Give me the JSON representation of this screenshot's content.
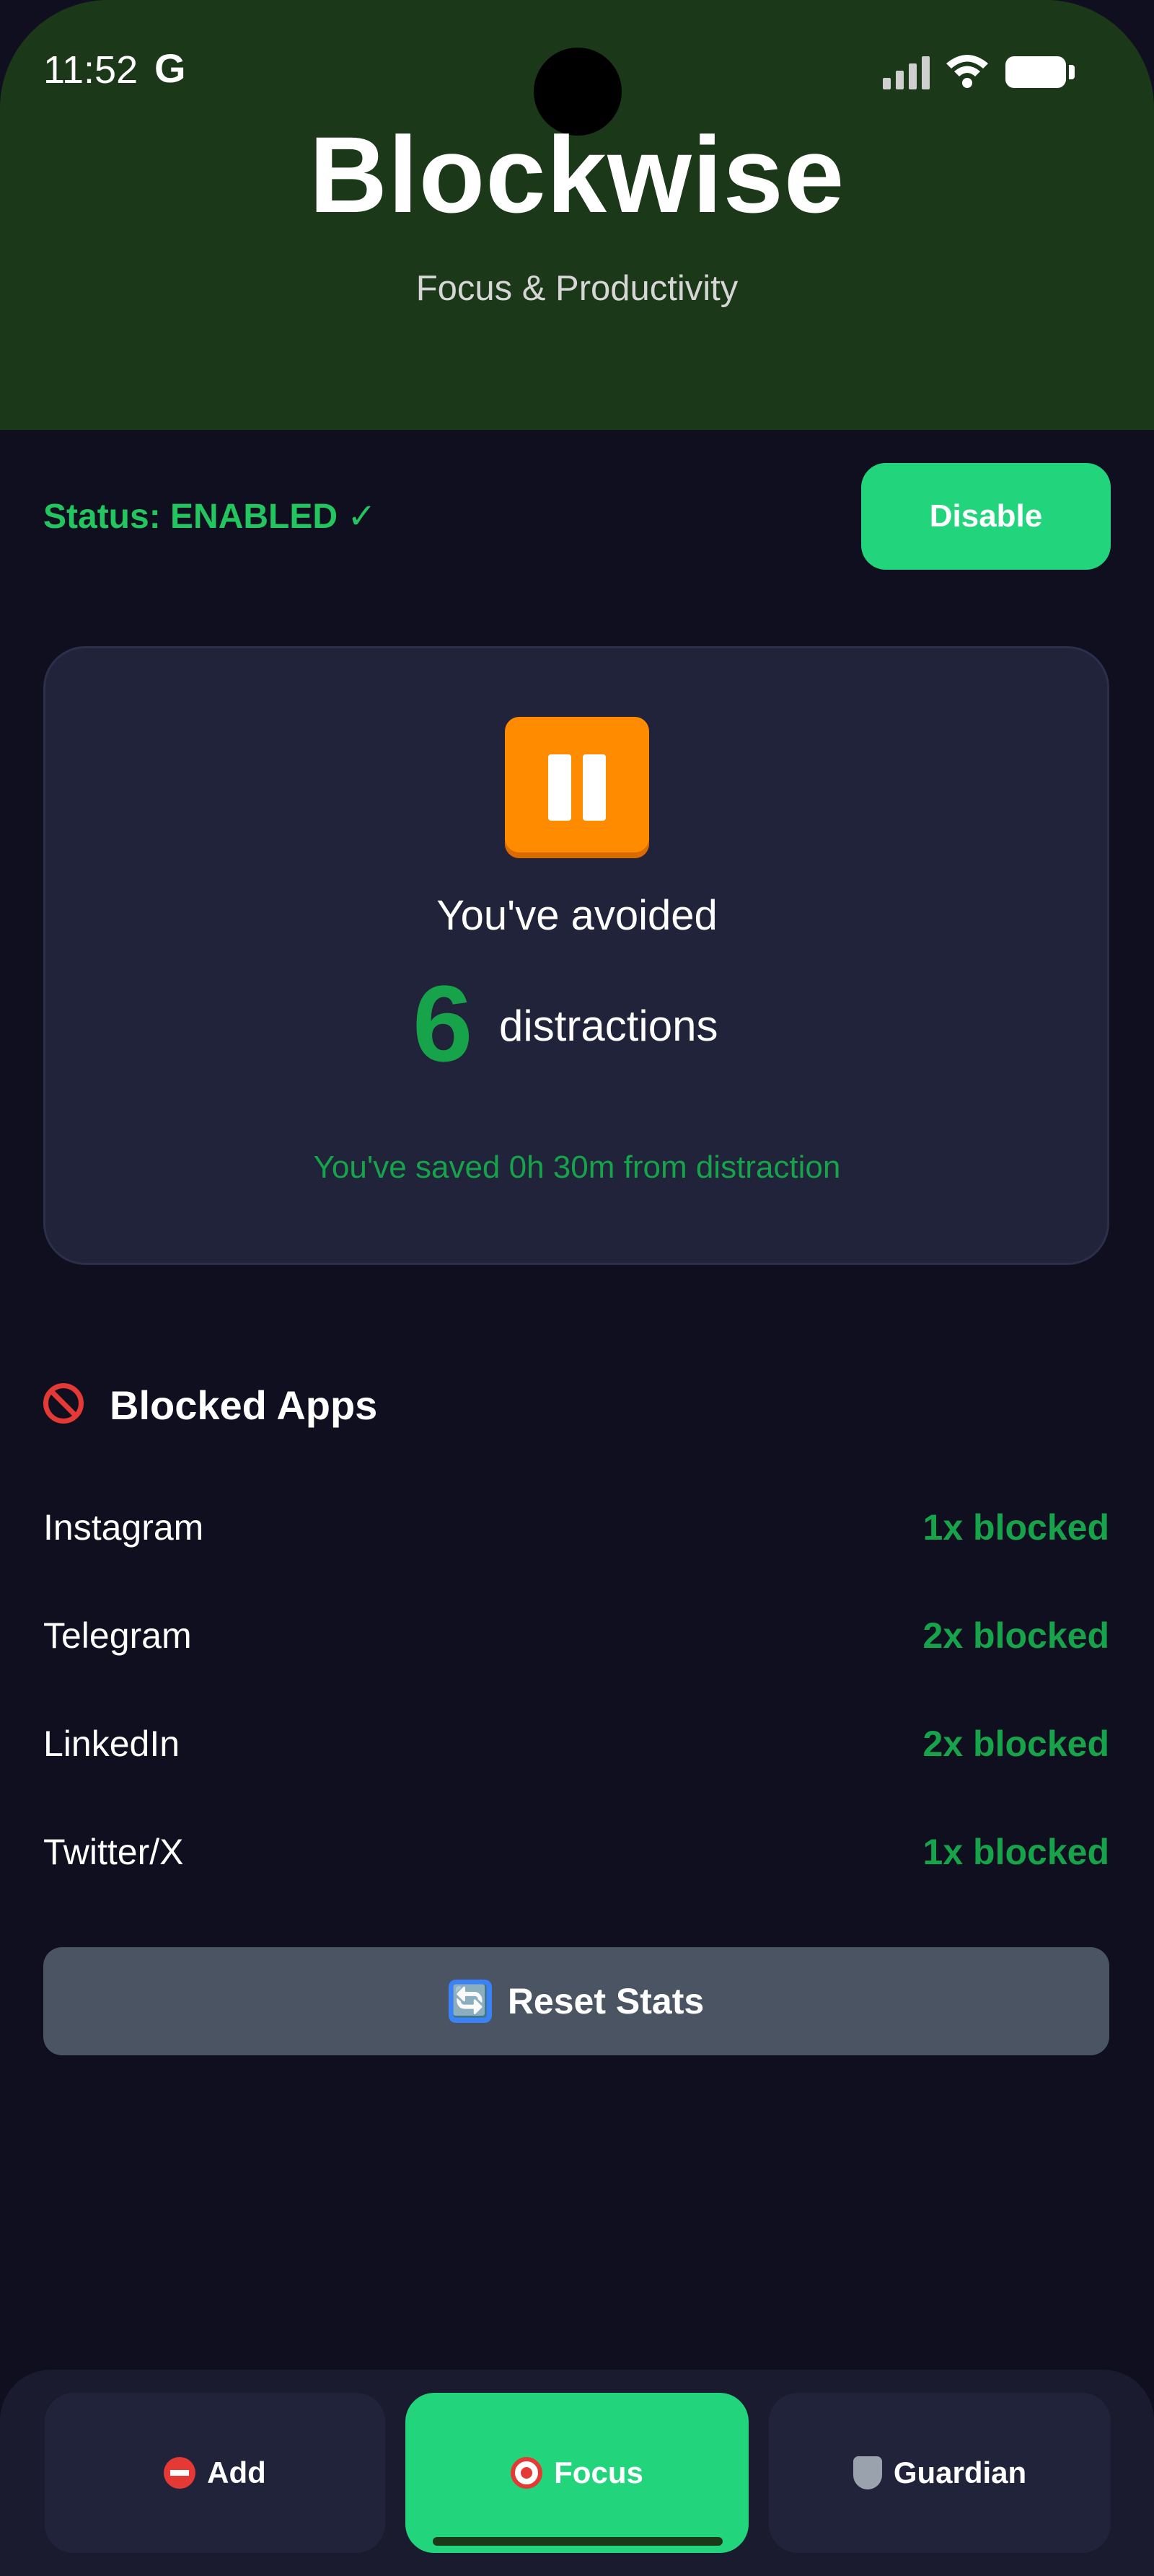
{
  "status_bar": {
    "time": "11:52",
    "g_label": "G"
  },
  "header": {
    "title": "Blockwise",
    "subtitle": "Focus & Productivity"
  },
  "status": {
    "text": "Status: ENABLED ✓",
    "button_label": "Disable"
  },
  "stats": {
    "avoided_text": "You've avoided",
    "count": "6",
    "count_label": "distractions",
    "saved_text": "You've saved 0h 30m from distraction"
  },
  "blocked_apps": {
    "title": "Blocked Apps",
    "items": [
      {
        "name": "Instagram",
        "count": "1x blocked"
      },
      {
        "name": "Telegram",
        "count": "2x blocked"
      },
      {
        "name": "LinkedIn",
        "count": "2x blocked"
      },
      {
        "name": "Twitter/X",
        "count": "1x blocked"
      }
    ]
  },
  "reset": {
    "label": "Reset Stats",
    "icon": "🔄"
  },
  "nav": {
    "add": "Add",
    "focus": "Focus",
    "guardian": "Guardian",
    "active": "focus"
  },
  "colors": {
    "header_bg": "#1b3818",
    "page_bg": "#0f0f20",
    "card_bg": "#20233a",
    "accent": "#22d47c",
    "success_text": "#16a34a",
    "reset_bg": "#4a5463"
  }
}
